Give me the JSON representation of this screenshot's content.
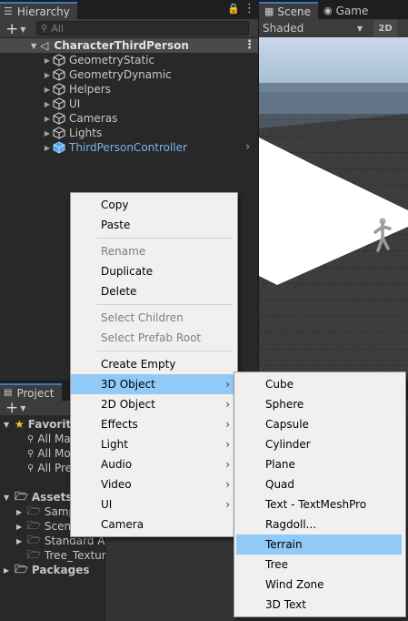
{
  "hierarchy": {
    "tab_label": "Hierarchy",
    "add_label": "+",
    "search_placeholder": "All",
    "scene_name": "CharacterThirdPerson",
    "items": [
      {
        "label": "GeometryStatic"
      },
      {
        "label": "GeometryDynamic"
      },
      {
        "label": "Helpers"
      },
      {
        "label": "UI"
      },
      {
        "label": "Cameras"
      },
      {
        "label": "Lights"
      },
      {
        "label": "ThirdPersonController"
      }
    ]
  },
  "scene_view": {
    "tabs": [
      {
        "label": "Scene"
      },
      {
        "label": "Game"
      }
    ],
    "shading_mode": "Shaded",
    "toggle_2d": "2D"
  },
  "project": {
    "tab_label": "Project",
    "add_label": "+",
    "favorites_label": "Favorites",
    "favorites_items": [
      {
        "label": "All Materials"
      },
      {
        "label": "All Models"
      },
      {
        "label": "All Prefabs"
      }
    ],
    "assets_label": "Assets",
    "assets_items": [
      {
        "label": "Samples"
      },
      {
        "label": "Scenes"
      },
      {
        "label": "Standard Assets"
      },
      {
        "label": "Tree_Textures"
      }
    ],
    "packages_label": "Packages"
  },
  "context_menu": {
    "copy": "Copy",
    "paste": "Paste",
    "rename": "Rename",
    "duplicate": "Duplicate",
    "delete": "Delete",
    "select_children": "Select Children",
    "select_prefab_root": "Select Prefab Root",
    "create_empty": "Create Empty",
    "object_3d": "3D Object",
    "object_2d": "2D Object",
    "effects": "Effects",
    "light": "Light",
    "audio": "Audio",
    "video": "Video",
    "ui": "UI",
    "camera": "Camera"
  },
  "submenu_3d": {
    "items": [
      {
        "label": "Cube"
      },
      {
        "label": "Sphere"
      },
      {
        "label": "Capsule"
      },
      {
        "label": "Cylinder"
      },
      {
        "label": "Plane"
      },
      {
        "label": "Quad"
      },
      {
        "label": "Text - TextMeshPro"
      },
      {
        "label": "Ragdoll..."
      },
      {
        "label": "Terrain"
      },
      {
        "label": "Tree"
      },
      {
        "label": "Wind Zone"
      },
      {
        "label": "3D Text"
      }
    ],
    "highlighted": "Terrain"
  },
  "colors": {
    "selection_blue": "#91c9f7",
    "prefab_blue": "#7bb2f0",
    "accent_tab": "#3a79bb"
  }
}
